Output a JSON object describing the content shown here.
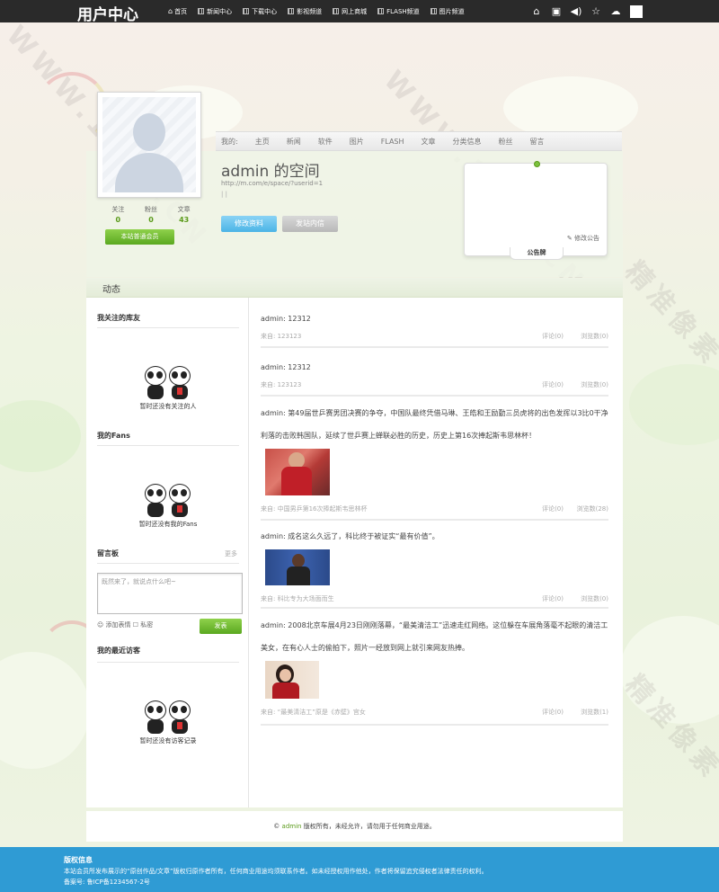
{
  "topbar": {
    "logo": "用户中心",
    "nav": [
      "首页",
      "新闻中心",
      "下载中心",
      "影视频道",
      "网上商城",
      "FLASH频道",
      "图片频道"
    ],
    "icons": [
      "home-icon",
      "inbox-icon",
      "volume-icon",
      "star-icon",
      "upload-icon"
    ]
  },
  "watermarks": [
    "WWW.11PX.CN",
    "精准像素"
  ],
  "profile": {
    "subnav_label": "我的:",
    "subnav": [
      "主页",
      "新闻",
      "软件",
      "图片",
      "FLASH",
      "文章",
      "分类信息",
      "粉丝",
      "留言"
    ],
    "title": "admin 的空间",
    "url": "http://m.com/e/space/?userid=1",
    "separator": "| |",
    "stats": [
      {
        "label": "关注",
        "value": "0"
      },
      {
        "label": "粉丝",
        "value": "0"
      },
      {
        "label": "文章",
        "value": "43"
      }
    ],
    "member_label": "本站普通会员",
    "edit_button": "修改资料",
    "msg_button": "发站内信",
    "notice_edit": "修改公告",
    "notice_label": "公告牌"
  },
  "dynamics_title": "动态",
  "sidebar": {
    "sections": [
      {
        "title": "我关注的库友",
        "empty": "暂时还没有关注的人"
      },
      {
        "title": "我的Fans",
        "empty": "暂时还没有我的Fans"
      }
    ],
    "guestbook_title": "留言板",
    "guestbook_more": "更多",
    "guestbook_placeholder": "既然来了，就说点什么吧~",
    "emoji_label": "添加表情",
    "private_label": "私密",
    "send_label": "发表",
    "visitors_title": "我的最近访客",
    "visitors_empty": "暂时还没有访客记录"
  },
  "feed": [
    {
      "text": "admin: 12312",
      "source": "来自: 123123",
      "comments": "评论(0)",
      "reads": "浏览数(0)"
    },
    {
      "text": "admin: 12312",
      "source": "来自: 123123",
      "comments": "评论(0)",
      "reads": "浏览数(0)"
    },
    {
      "text": "admin: 第49届世乒赛男团决赛的争夺，中国队最终凭借马琳、王皓和王励勤三员虎将的出色发挥以3比0干净利落的击败韩国队，延续了世乒赛上蝉联必胜的历史，历史上第16次捧起斯韦思林杯！",
      "source": "来自: 中国男乒第16次捧起斯韦思林杯",
      "comments": "评论(0)",
      "reads": "浏览数(28)",
      "thumb": "pingpong"
    },
    {
      "text": "admin: 成名这么久远了，科比终于被证实“最有价值”。",
      "source": "来自: 科比专为大场面而生",
      "comments": "评论(0)",
      "reads": "浏览数(0)",
      "thumb": "kobe"
    },
    {
      "text": "admin: 2008北京车展4月23日刚刚落幕，“最美清洁工”迅速走红网络。这位躲在车展角落毫不起眼的清洁工美女，在有心人士的偷拍下，照片一经放到网上就引来网友热捧。",
      "source": "来自: “最美清洁工”原是《赤壁》宫女",
      "comments": "评论(0)",
      "reads": "浏览数(1)",
      "thumb": "girl"
    }
  ],
  "footer": {
    "prefix": "©",
    "admin": "admin",
    "text": "版权所有，未经允许，请勿用于任何商业用途。"
  },
  "copyright": {
    "title": "版权信息",
    "line1": "本站会员所发布展示的“原创作品/文章”版权归原作者所有，任何商业用途均须联系作者。如未经授权用作他处，作者将保留追究侵权者法律责任的权利。",
    "line2": "备案号: 鲁ICP备1234567-2号"
  }
}
